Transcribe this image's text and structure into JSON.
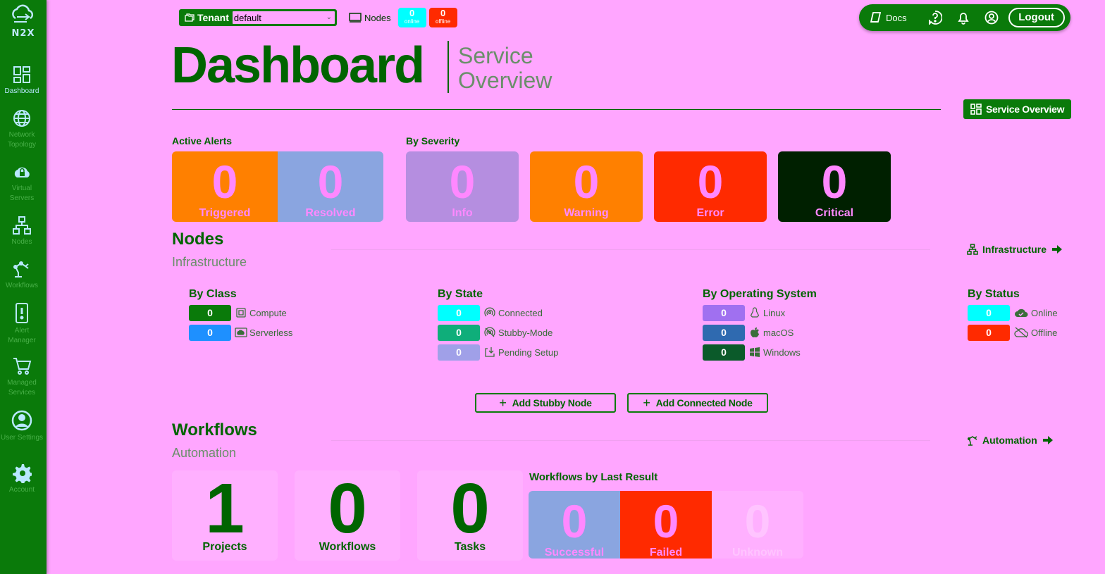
{
  "brand": {
    "logo_text": "N2X"
  },
  "sidebar": {
    "items": [
      {
        "label": "Dashboard",
        "icon": "dashboard-icon"
      },
      {
        "label": "Network Topology",
        "icon": "globe-icon"
      },
      {
        "label": "Virtual Servers",
        "icon": "lock-cloud-icon"
      },
      {
        "label": "Nodes",
        "icon": "nodes-icon"
      },
      {
        "label": "Workflows",
        "icon": "robot-arm-icon"
      },
      {
        "label": "Alert Manager",
        "icon": "alert-phone-icon"
      },
      {
        "label": "Managed Services",
        "icon": "cart-icon"
      },
      {
        "label": "User Settings",
        "icon": "user-icon"
      },
      {
        "label": "Account",
        "icon": "gear-icon"
      }
    ]
  },
  "topbar": {
    "tenant_label": "Tenant",
    "tenant_value": "default",
    "nodes_label": "Nodes",
    "online_count": "0",
    "online_label": "online",
    "offline_count": "0",
    "offline_label": "offline",
    "docs_label": "Docs",
    "logout_label": "Logout"
  },
  "header": {
    "title": "Dashboard",
    "subtitle_line1": "Service",
    "subtitle_line2": "Overview",
    "service_overview_button": "Service Overview"
  },
  "alerts": {
    "active_label": "Active Alerts",
    "severity_label": "By Severity",
    "active": [
      {
        "value": "0",
        "label": "Triggered",
        "color": "#ff8000"
      },
      {
        "value": "0",
        "label": "Resolved",
        "color": "#8aa5e0"
      }
    ],
    "severity": [
      {
        "value": "0",
        "label": "Info",
        "color": "#b58ee0"
      },
      {
        "value": "0",
        "label": "Warning",
        "color": "#ff8000"
      },
      {
        "value": "0",
        "label": "Error",
        "color": "#ff2a00"
      },
      {
        "value": "0",
        "label": "Critical",
        "color": "#002000"
      }
    ]
  },
  "nodes": {
    "title": "Nodes",
    "subtitle": "Infrastructure",
    "link": "Infrastructure",
    "by_class": {
      "title": "By Class",
      "rows": [
        {
          "value": "0",
          "label": "Compute",
          "color": "#0a7a0a"
        },
        {
          "value": "0",
          "label": "Serverless",
          "color": "#1e90ff"
        }
      ]
    },
    "by_state": {
      "title": "By State",
      "rows": [
        {
          "value": "0",
          "label": "Connected",
          "color": "#00ffff"
        },
        {
          "value": "0",
          "label": "Stubby-Mode",
          "color": "#0fae7a"
        },
        {
          "value": "0",
          "label": "Pending Setup",
          "color": "#a0a0e8"
        }
      ]
    },
    "by_os": {
      "title": "By Operating System",
      "rows": [
        {
          "value": "0",
          "label": "Linux",
          "color": "#a070f0"
        },
        {
          "value": "0",
          "label": "macOS",
          "color": "#2f6ab0"
        },
        {
          "value": "0",
          "label": "Windows",
          "color": "#0b5a2a"
        }
      ]
    },
    "by_status": {
      "title": "By Status",
      "rows": [
        {
          "value": "0",
          "label": "Online",
          "color": "#00ffff"
        },
        {
          "value": "0",
          "label": "Offline",
          "color": "#ff2a00"
        }
      ]
    },
    "add_stubby": "Add Stubby Node",
    "add_connected": "Add Connected Node"
  },
  "workflows": {
    "title": "Workflows",
    "subtitle": "Automation",
    "link": "Automation",
    "cards": [
      {
        "value": "1",
        "label": "Projects"
      },
      {
        "value": "0",
        "label": "Workflows"
      },
      {
        "value": "0",
        "label": "Tasks"
      }
    ],
    "last_result_label": "Workflows by Last Result",
    "results": [
      {
        "value": "0",
        "label": "Successful",
        "color": "#8aa5e0"
      },
      {
        "value": "0",
        "label": "Failed",
        "color": "#ff2a00"
      },
      {
        "value": "0",
        "label": "Unknown",
        "color": "#ffb0ff"
      }
    ]
  }
}
